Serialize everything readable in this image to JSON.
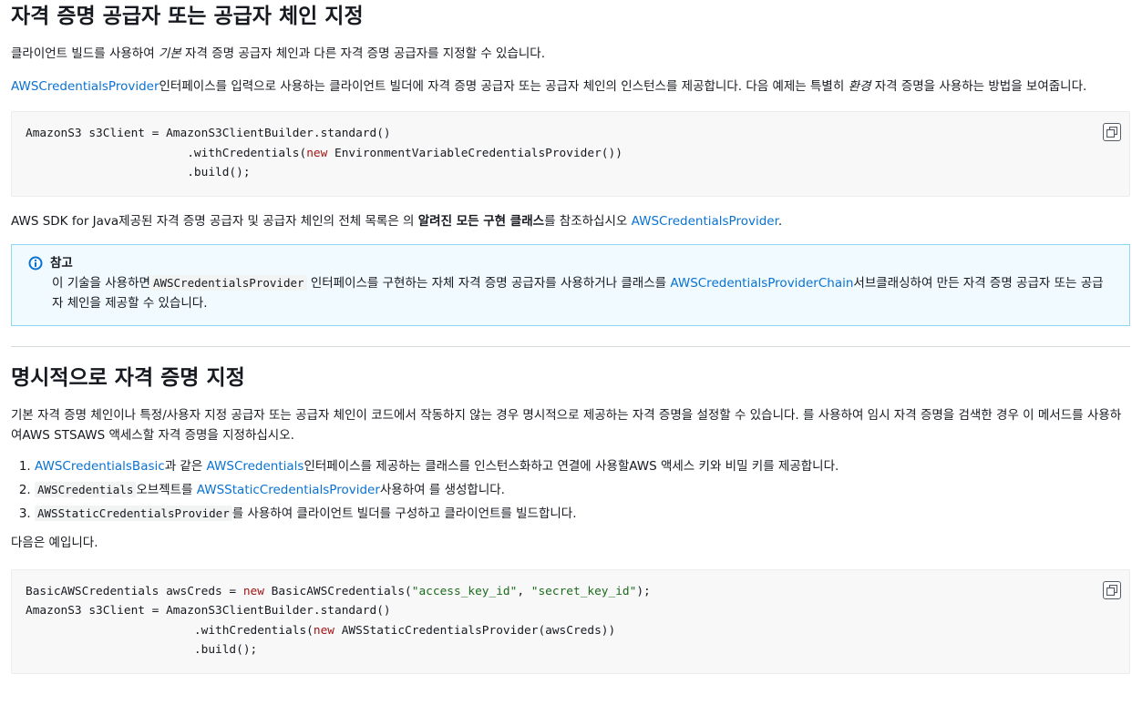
{
  "section1": {
    "title": "자격 증명 공급자 또는 공급자 체인 지정",
    "intro_a": "클라이언트 빌드를 사용하여 ",
    "intro_em": "기본",
    "intro_b": " 자격 증명 공급자 체인과 다른 자격 증명 공급자를 지정할 수 있습니다.",
    "para2_link": "AWSCredentialsProvider",
    "para2_a": "인터페이스를 입력으로 사용하는 클라이언트 빌더에 자격 증명 공급자 또는 공급자 체인의 인스턴스를 제공합니다. 다음 예제는 특별히 ",
    "para2_em": "환경",
    "para2_b": " 자격 증명을 사용하는 방법을 보여줍니다.",
    "code": {
      "l1": "AmazonS3 s3Client = AmazonS3ClientBuilder.standard()",
      "l2_a": "                       .withCredentials(",
      "l2_kw": "new",
      "l2_b": " EnvironmentVariableCredentialsProvider())",
      "l3": "                       .build();"
    },
    "para3_a": "AWS SDK for Java제공된 자격 증명 공급자 및 공급자 체인의 전체 목록은 의 ",
    "para3_strong": "알려진 모든 구현 클래스",
    "para3_b": "를 참조하십시오 ",
    "para3_link": "AWSCredentialsProvider",
    "para3_c": "."
  },
  "note": {
    "title": "참고",
    "a": "이 기술을 사용하면",
    "code": "AWSCredentialsProvider",
    "b": " 인터페이스를 구현하는 자체 자격 증명 공급자를 사용하거나 클래스를 ",
    "link": "AWSCredentialsProviderChain",
    "c": "서브클래싱하여 만든 자격 증명 공급자 또는 공급자 체인을 제공할 수 있습니다."
  },
  "section2": {
    "title": "명시적으로 자격 증명 지정",
    "para": "기본 자격 증명 체인이나 특정/사용자 지정 공급자 또는 공급자 체인이 코드에서 작동하지 않는 경우 명시적으로 제공하는 자격 증명을 설정할 수 있습니다. 를 사용하여 임시 자격 증명을 검색한 경우 이 메서드를 사용하여AWS STSAWS 액세스할 자격 증명을 지정하십시오.",
    "steps": [
      {
        "link1": "AWSCredentialsBasic",
        "a": "과 같은 ",
        "link2": "AWSCredentials",
        "b": "인터페이스를 제공하는 클래스를 인스턴스화하고 연결에 사용할AWS 액세스 키와 비밀 키를 제공합니다."
      },
      {
        "code": "AWSCredentials",
        "a": "오브젝트를 ",
        "link": "AWSStaticCredentialsProvider",
        "b": "사용하여 를 생성합니다."
      },
      {
        "code": "AWSStaticCredentialsProvider",
        "a": "를 사용하여 클라이언트 빌더를 구성하고 클라이언트를 빌드합니다."
      }
    ],
    "example_intro": "다음은 예입니다.",
    "code": {
      "l1_a": "BasicAWSCredentials awsCreds = ",
      "l1_kw": "new",
      "l1_b": " BasicAWSCredentials(",
      "l1_s1": "\"access_key_id\"",
      "l1_c": ", ",
      "l1_s2": "\"secret_key_id\"",
      "l1_d": ");",
      "l2": "AmazonS3 s3Client = AmazonS3ClientBuilder.standard()",
      "l3_a": "                        .withCredentials(",
      "l3_kw": "new",
      "l3_b": " AWSStaticCredentialsProvider(awsCreds))",
      "l4": "                        .build();"
    }
  }
}
